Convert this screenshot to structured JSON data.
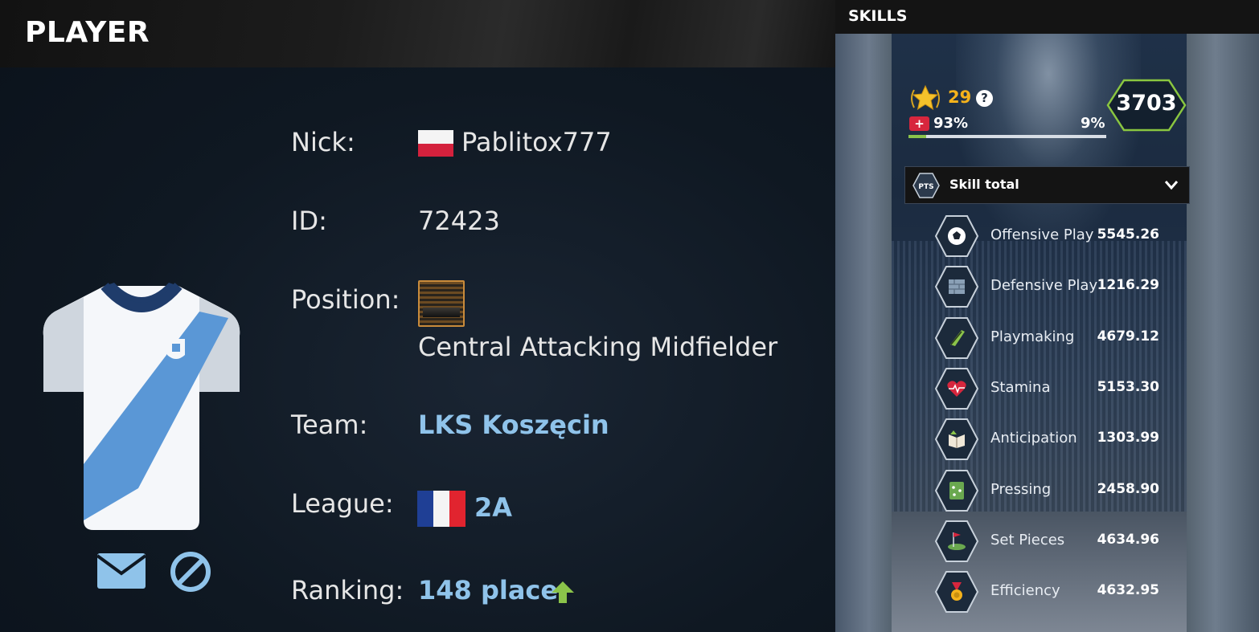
{
  "player_panel": {
    "title": "PLAYER",
    "nick_label": "Nick:",
    "nick": "Pablitox777",
    "id_label": "ID:",
    "id": "72423",
    "position_label": "Position:",
    "position": "Central Attacking Midfielder",
    "team_label": "Team:",
    "team": "LKS Koszęcin",
    "league_label": "League:",
    "league": "2A",
    "ranking_label": "Ranking:",
    "ranking": "148 place"
  },
  "skills_panel": {
    "title": "SKILLS",
    "level": "29",
    "help": "?",
    "health_pct": "93%",
    "xp_pct": "9%",
    "xp_fraction": 0.09,
    "total": "3703",
    "select": {
      "selected": "Skill total",
      "icon_text": "PTS"
    },
    "skills": [
      {
        "name": "Offensive Play",
        "value": "5545.26",
        "icon": "football-icon"
      },
      {
        "name": "Defensive Play",
        "value": "1216.29",
        "icon": "wall-icon"
      },
      {
        "name": "Playmaking",
        "value": "4679.12",
        "icon": "boot-icon"
      },
      {
        "name": "Stamina",
        "value": "5153.30",
        "icon": "heart-pulse-icon"
      },
      {
        "name": "Anticipation",
        "value": "1303.99",
        "icon": "book-icon"
      },
      {
        "name": "Pressing",
        "value": "2458.90",
        "icon": "tactics-board-icon"
      },
      {
        "name": "Set Pieces",
        "value": "4634.96",
        "icon": "corner-flag-icon"
      },
      {
        "name": "Efficiency",
        "value": "4632.95",
        "icon": "medal-icon"
      }
    ]
  },
  "colors": {
    "accent_link": "#8fc3ea",
    "level_gold": "#f5b21b",
    "xp_green": "#8bc34a",
    "hex_green": "#8ac640"
  }
}
